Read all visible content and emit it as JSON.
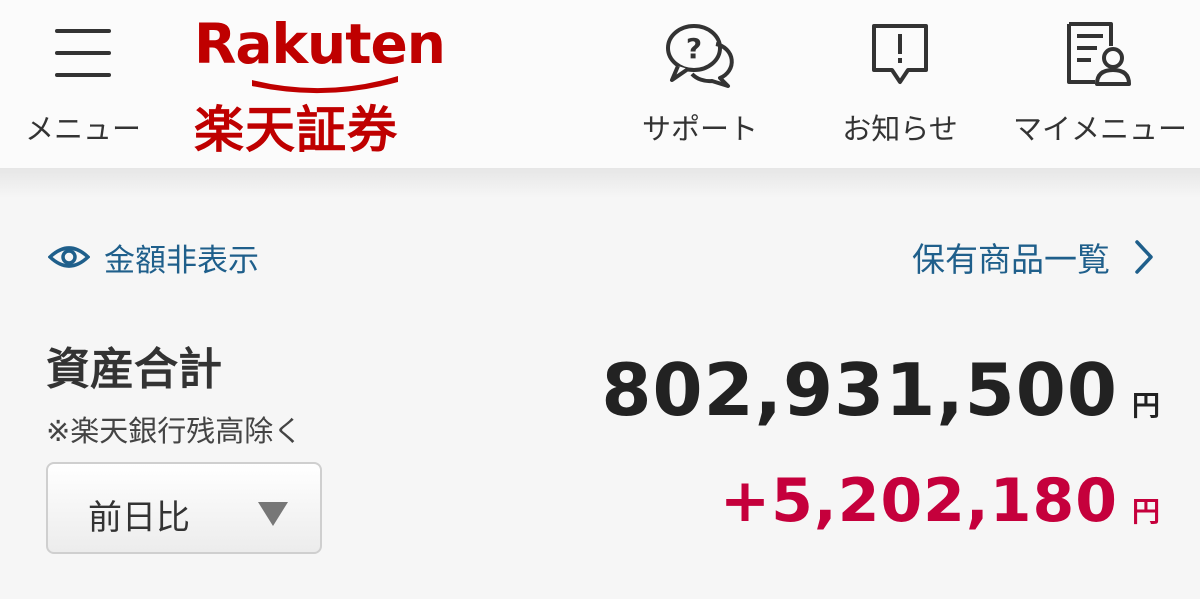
{
  "header": {
    "menu_label": "メニュー",
    "support_label": "サポート",
    "notices_label": "お知らせ",
    "my_menu_label": "マイメニュー",
    "logo": {
      "en": "Rakuten",
      "jp": "楽天証券"
    }
  },
  "actions": {
    "hide_amounts_label": "金額非表示",
    "holdings_list_label": "保有商品一覧"
  },
  "assets": {
    "title": "資産合計",
    "note": "※楽天銀行残高除く",
    "total_value": "802,931,500",
    "total_unit": "円",
    "compare_select": {
      "selected": "前日比"
    },
    "change_value": "+5,202,180",
    "change_unit": "円"
  },
  "colors": {
    "brand": "#bf0000",
    "link": "#1f5f8b",
    "positive_change": "#c5003c",
    "text": "#333333"
  },
  "icons": {
    "menu": "hamburger-icon",
    "support": "chat-question-icon",
    "notices": "exclamation-speech-icon",
    "my_menu": "document-user-icon",
    "hide_amounts": "eye-icon",
    "holdings_link": "chevron-right-icon",
    "compare_select": "caret-down-icon"
  }
}
